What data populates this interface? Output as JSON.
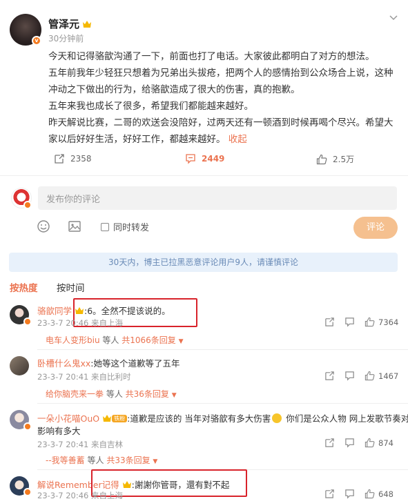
{
  "post": {
    "username": "管泽元",
    "time": "30分钟前",
    "paragraphs": [
      "今天和记得骆歆沟通了一下，前面也打了电话。大家彼此都明白了对方的想法。",
      "五年前我年少轻狂只想着为兄弟出头拔疮，把两个人的感情抬到公众场合上说，这种冲动之下做出的行为，给骆歆造成了很大的伤害，真的抱歉。",
      "五年来我也成长了很多，希望我们都能越来越好。",
      "昨天解说比赛，二哥的欢送会没陪好，过两天还有一顿酒到时候再喝个尽兴。希望大家以后好好生活，好好工作，都越来越好。"
    ],
    "collapse_label": "收起",
    "repost_count": "2358",
    "comment_count": "2449",
    "like_count": "2.5万"
  },
  "compose": {
    "placeholder": "发布你的评论",
    "forward_label": "同时转发",
    "submit_label": "评论"
  },
  "notice": "30天内，博主已拉黑恶意评论用户9人，请谨慎评论",
  "tabs": {
    "hot": "按热度",
    "time": "按时间"
  },
  "comments": [
    {
      "name": "骆歆同学",
      "text": ":6。全然不提该说的。",
      "meta": "23-3-7 20:46 来自上海",
      "likes": "7364",
      "reply_user": "电车人变形biu",
      "reply_mid": " 等人 ",
      "reply_count": "共1066条回复"
    },
    {
      "name": "卧槽什么鬼xx",
      "text": ":她等这个道歉等了五年",
      "meta": "23-3-7 20:41 来自比利时",
      "likes": "1467",
      "reply_user": "给你脑壳来一拳",
      "reply_mid": " 等人 ",
      "reply_count": "共36条回复"
    },
    {
      "name": "一朵小花喵OuO",
      "group_badge": "铁粉",
      "text": ":道歉是应该的 当年对骆歆有多大伤害",
      "text2": " 你们是公众人物 网上发歌节奏对别人",
      "text3": "影响有多大",
      "meta": "23-3-7 20:41 来自吉林",
      "likes": "874",
      "reply_user": "--我等善蓄",
      "reply_mid": " 等人 ",
      "reply_count": "共33条回复"
    },
    {
      "name": "解说Remember",
      "name2": "记得",
      "text": ":謝謝你管哥，還有對不起",
      "meta": "23-3-7 20:46 来自上海",
      "likes": "648"
    }
  ],
  "colors": {
    "accent": "#eb7350",
    "notice_bg": "#e8f1fb",
    "highlight_box": "#d8222a"
  }
}
